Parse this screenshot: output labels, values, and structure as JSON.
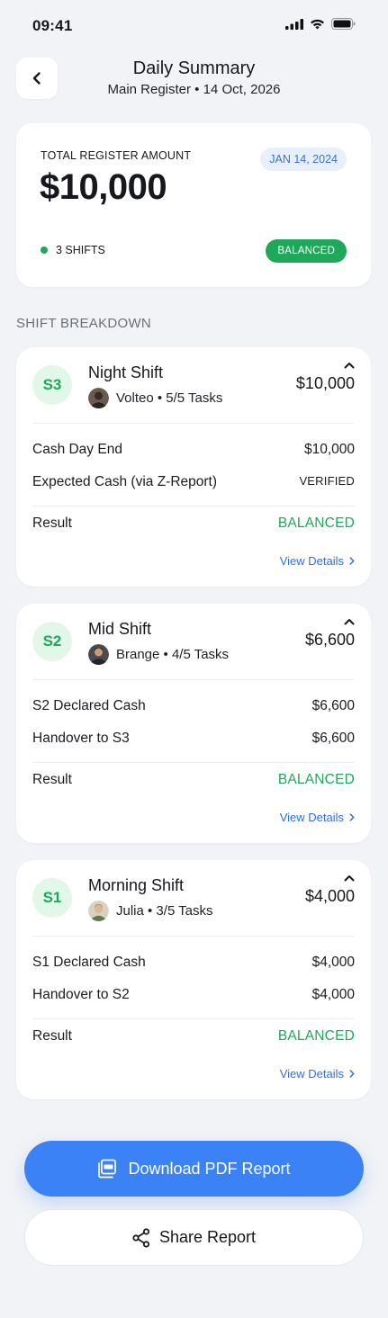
{
  "status_bar": {
    "time": "09:41"
  },
  "header": {
    "title": "Daily Summary",
    "subtitle": "Main Register • 14 Oct, 2026"
  },
  "summary": {
    "label": "TOTAL REGISTER AMOUNT",
    "date_chip": "JAN 14, 2024",
    "amount": "$10,000",
    "shifts_count": "3 SHIFTS",
    "status_badge": "BALANCED",
    "status_color": "#1fa85a"
  },
  "section_title": "SHIFT BREAKDOWN",
  "shifts": [
    {
      "code": "S3",
      "name": "Night Shift",
      "meta": "Volteo • 5/5 Tasks",
      "total": "$10,000",
      "rows": [
        {
          "label": "Cash Day End",
          "value": "$10,000"
        },
        {
          "label": "Expected Cash (via Z-Report)",
          "value": "VERIFIED"
        }
      ],
      "result_label": "Result",
      "result_value": "BALANCED",
      "view_details": "View Details"
    },
    {
      "code": "S2",
      "name": "Mid Shift",
      "meta": "Brange • 4/5 Tasks",
      "total": "$6,600",
      "rows": [
        {
          "label": "S2 Declared Cash",
          "value": "$6,600"
        },
        {
          "label": "Handover to S3",
          "value": "$6,600"
        }
      ],
      "result_label": "Result",
      "result_value": "BALANCED",
      "view_details": "View Details"
    },
    {
      "code": "S1",
      "name": "Morning Shift",
      "meta": "Julia • 3/5 Tasks",
      "total": "$4,000",
      "rows": [
        {
          "label": "S1 Declared Cash",
          "value": "$4,000"
        },
        {
          "label": "Handover to S2",
          "value": "$4,000"
        }
      ],
      "result_label": "Result",
      "result_value": "BALANCED",
      "view_details": "View Details"
    }
  ],
  "actions": {
    "download_label": "Download PDF Report",
    "share_label": "Share Report",
    "primary_color": "#3b82f6"
  },
  "icons": {
    "back": "chevron-left-icon",
    "collapse": "chevron-up-icon",
    "details": "chevron-right-icon",
    "download": "pdf-document-icon",
    "share": "share-icon"
  }
}
